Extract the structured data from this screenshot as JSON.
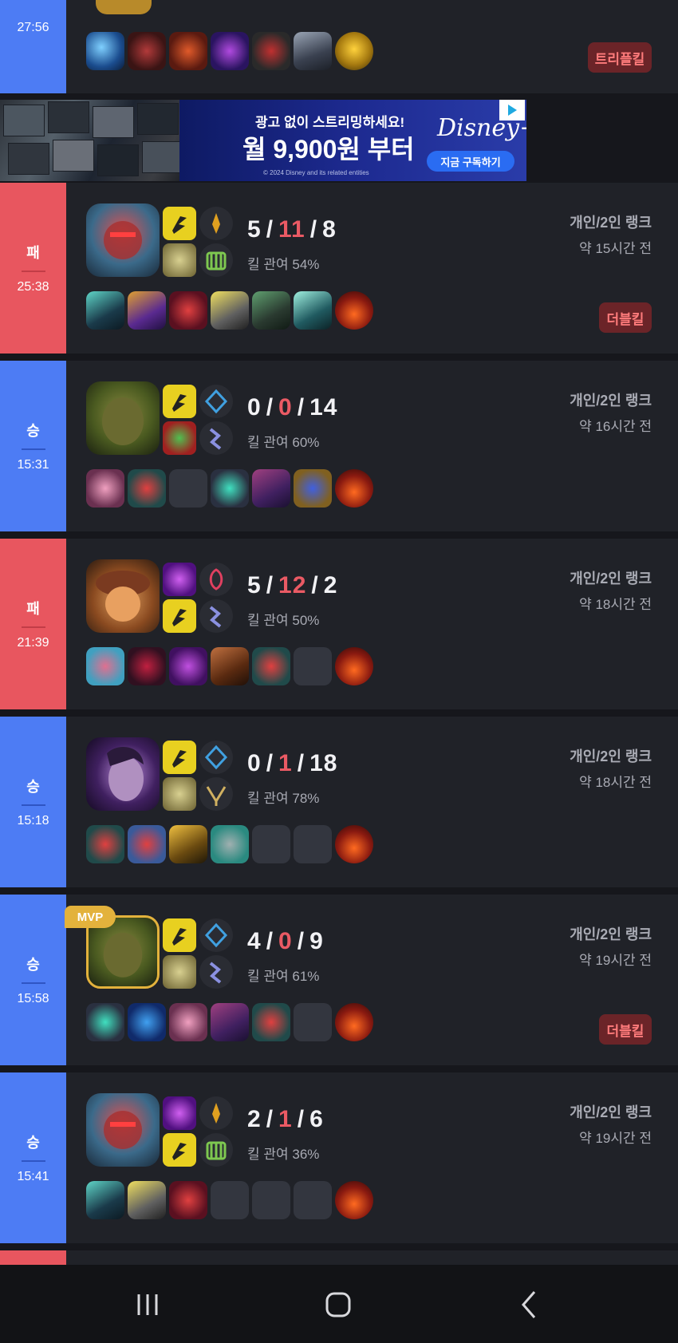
{
  "ad": {
    "line1": "광고 없이 스트리밍하세요!",
    "line2": "월 9,900원 부터",
    "brand": "Disney+",
    "cta": "지금 구독하기",
    "copyright": "© 2024 Disney and its related entities"
  },
  "top_match": {
    "duration": "27:56",
    "multikill": "트리플킬"
  },
  "matches": [
    {
      "result": "패",
      "duration": "25:38",
      "kills": "5",
      "deaths": "11",
      "assists": "8",
      "kill_participation": "킬 관여 54%",
      "queue": "개인/2인 랭크",
      "ago": "약 15시간 전",
      "multikill": "더블킬"
    },
    {
      "result": "승",
      "duration": "15:31",
      "kills": "0",
      "deaths": "0",
      "assists": "14",
      "kill_participation": "킬 관여 60%",
      "queue": "개인/2인 랭크",
      "ago": "약 16시간 전",
      "multikill": ""
    },
    {
      "result": "패",
      "duration": "21:39",
      "kills": "5",
      "deaths": "12",
      "assists": "2",
      "kill_participation": "킬 관여 50%",
      "queue": "개인/2인 랭크",
      "ago": "약 18시간 전",
      "multikill": ""
    },
    {
      "result": "승",
      "duration": "15:18",
      "kills": "0",
      "deaths": "1",
      "assists": "18",
      "kill_participation": "킬 관여 78%",
      "queue": "개인/2인 랭크",
      "ago": "약 18시간 전",
      "multikill": ""
    },
    {
      "result": "승",
      "duration": "15:58",
      "kills": "4",
      "deaths": "0",
      "assists": "9",
      "kill_participation": "킬 관여 61%",
      "queue": "개인/2인 랭크",
      "ago": "약 19시간 전",
      "multikill": "더블킬",
      "mvp": "MVP"
    },
    {
      "result": "승",
      "duration": "15:41",
      "kills": "2",
      "deaths": "1",
      "assists": "6",
      "kill_participation": "킬 관여 36%",
      "queue": "개인/2인 랭크",
      "ago": "약 19시간 전",
      "multikill": ""
    }
  ],
  "colors": {
    "win": "#4d7cf4",
    "loss": "#e8565f",
    "deaths": "#ea5a64",
    "mvp": "#e3b23c",
    "card_bg": "#202228"
  },
  "icons": {
    "nav": [
      "recent-apps-icon",
      "home-icon",
      "back-icon"
    ]
  }
}
